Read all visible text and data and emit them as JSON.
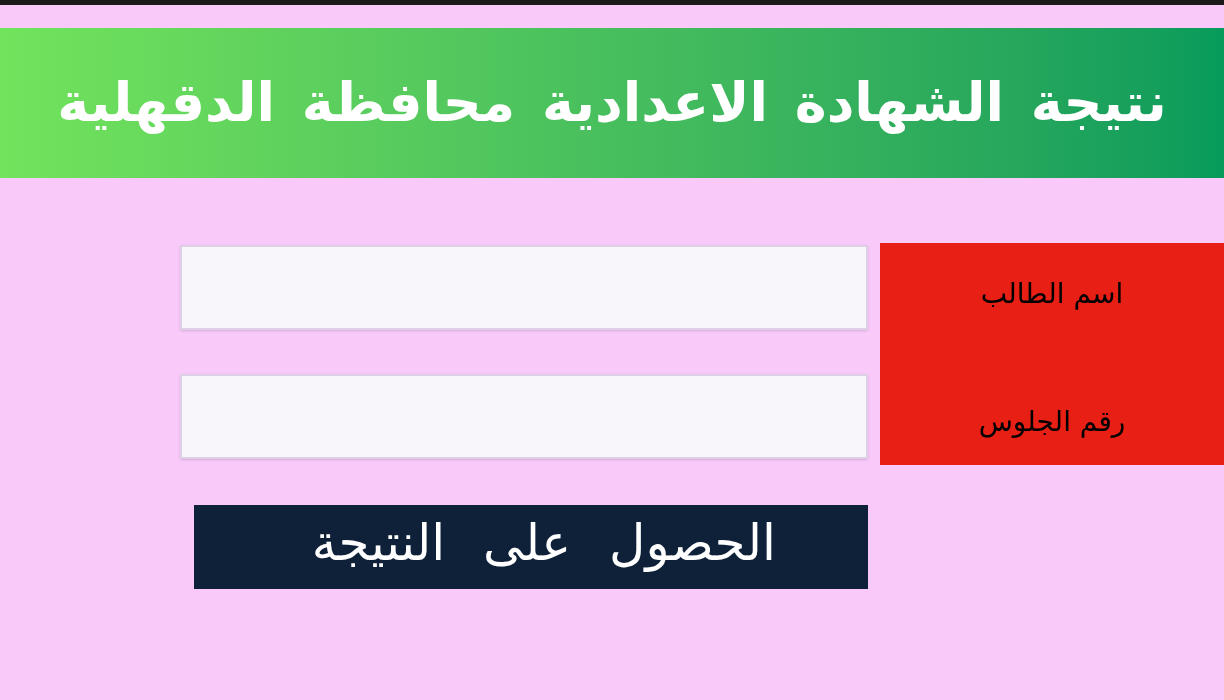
{
  "banner": {
    "title": "نتيجة الشهادة الاعدادية محافظة الدقهلية"
  },
  "form": {
    "fields": [
      {
        "label": "اسم الطالب"
      },
      {
        "label": "رقم الجلوس"
      }
    ],
    "submit_button": "الحصول على النتيجة"
  }
}
